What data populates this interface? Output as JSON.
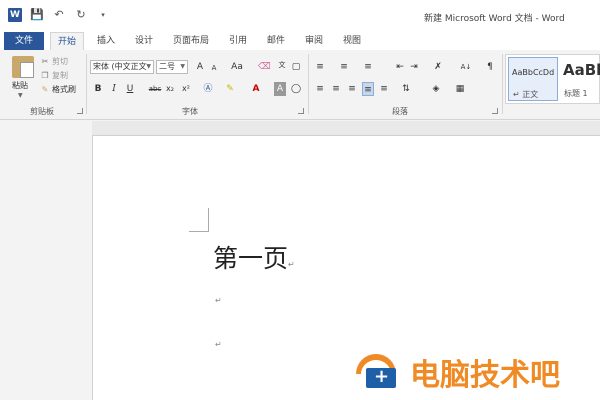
{
  "window": {
    "app_icon": "W",
    "title": "新建 Microsoft Word 文档 - Word",
    "qat": [
      "save-icon",
      "undo-icon",
      "redo-icon",
      "customize-icon"
    ]
  },
  "tabs": {
    "file": "文件",
    "items": [
      "开始",
      "插入",
      "设计",
      "页面布局",
      "引用",
      "邮件",
      "审阅",
      "视图"
    ],
    "active": "开始"
  },
  "ribbon": {
    "clipboard": {
      "label": "剪贴板",
      "paste": "粘贴",
      "cut": "剪切",
      "copy": "复制",
      "format_painter": "格式刷"
    },
    "font": {
      "label": "字体",
      "font_name": "宋体 (中文正文",
      "font_size": "二号",
      "grow": "A",
      "shrink": "A",
      "change_case": "Aa",
      "bold": "B",
      "italic": "I",
      "underline": "U",
      "strikethrough": "abc",
      "subscript": "x₂",
      "superscript": "x²"
    },
    "paragraph": {
      "label": "段落"
    },
    "styles": {
      "normal_sample": "AaBbCcDd",
      "normal_name": "↵ 正文",
      "heading_sample": "AaBl",
      "heading_name": "标题 1"
    }
  },
  "document": {
    "heading": "第一页",
    "para_mark": "↵"
  },
  "watermark": {
    "text": "电脑技术吧"
  },
  "colors": {
    "accent": "#2b579a",
    "watermark_orange": "#f08a24",
    "watermark_blue": "#1f5fa8"
  }
}
